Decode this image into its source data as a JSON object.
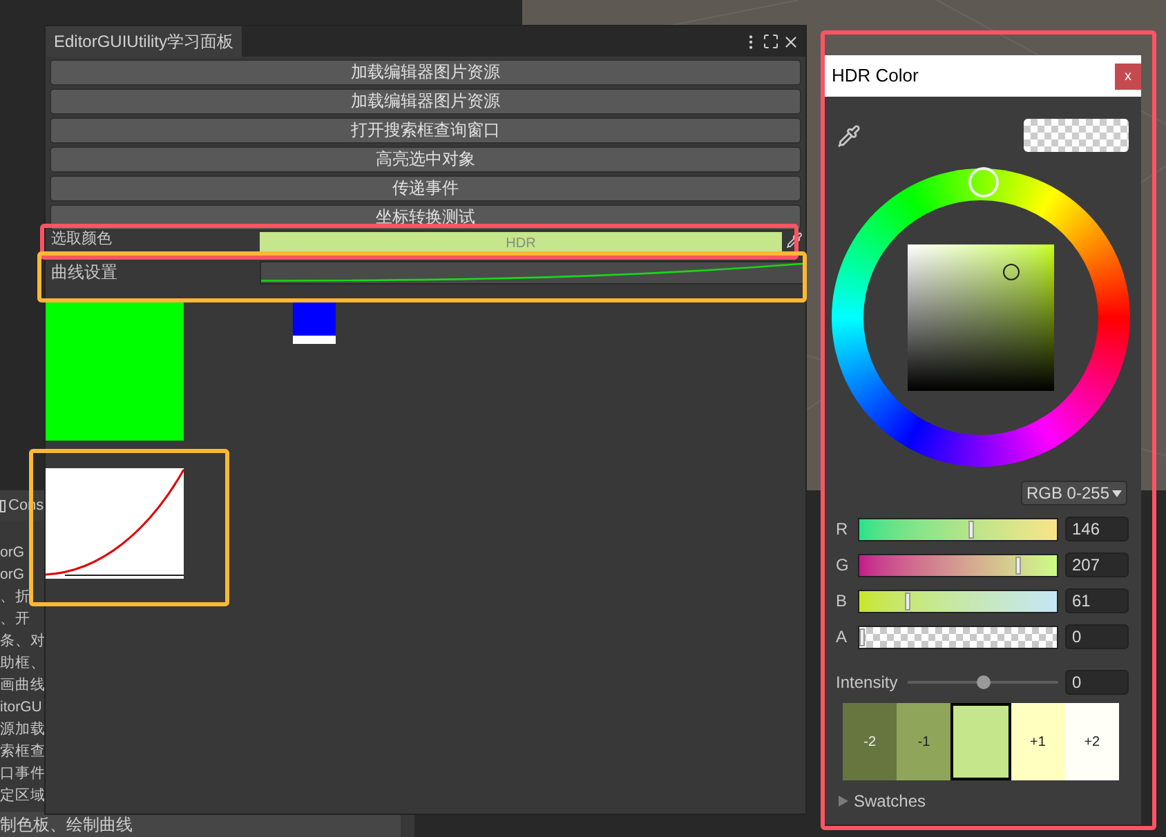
{
  "console": {
    "title": "Cons",
    "lines": [
      "orG",
      "orG",
      "、折",
      "、开",
      "条、对",
      "助框、",
      "画曲线",
      "itorGU",
      "源加载",
      "索框查",
      "口事件",
      "定区域"
    ],
    "footer": "制色板、绘制曲线"
  },
  "panel": {
    "title": "EditorGUIUtility学习面板",
    "buttons": [
      "加载编辑器图片资源",
      "加载编辑器图片资源",
      "打开搜索框查询窗口",
      "高亮选中对象",
      "传递事件",
      "坐标转换测试"
    ],
    "color_field": {
      "label": "选取颜色",
      "badge": "HDR",
      "color": "#c5e68a"
    },
    "curve_field": {
      "label": "曲线设置"
    }
  },
  "hdr_window": {
    "title": "HDR Color",
    "close": "x",
    "mode": "RGB 0-255",
    "channels": [
      {
        "name": "R",
        "level": 0.57,
        "value": "146"
      },
      {
        "name": "G",
        "level": 0.81,
        "value": "207"
      },
      {
        "name": "B",
        "level": 0.24,
        "value": "61"
      },
      {
        "name": "A",
        "level": 0,
        "value": "0"
      }
    ],
    "intensity": {
      "label": "Intensity",
      "level": 0.5,
      "value": "0"
    },
    "swatches": [
      {
        "label": "-2",
        "color": "#67763f",
        "selected": false
      },
      {
        "label": "-1",
        "color": "#8fa55a",
        "selected": false
      },
      {
        "color": "#c5e68a",
        "selected": true
      },
      {
        "label": "+1",
        "color": "#ffffc0",
        "selected": false
      },
      {
        "label": "+2",
        "color": "#fffff8",
        "selected": false
      }
    ],
    "swatches_foldout": {
      "label": "Swatches",
      "expanded": false
    }
  },
  "annotations": [
    {
      "color": "#ff5464"
    },
    {
      "color": "#ffb833"
    },
    {
      "color": "#ffb833"
    },
    {
      "color": "#ff5464"
    }
  ]
}
